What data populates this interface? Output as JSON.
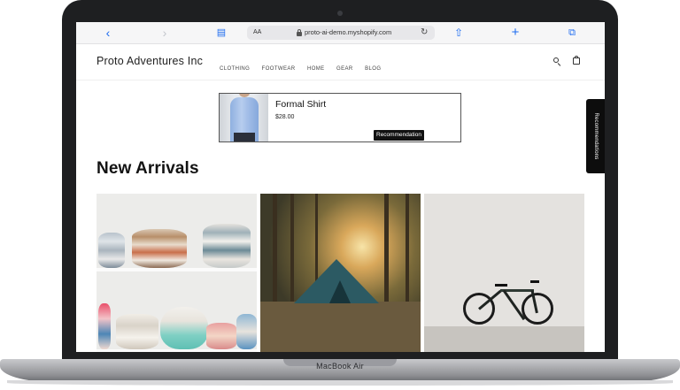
{
  "device": {
    "model_label": "MacBook Air"
  },
  "browser": {
    "url": "proto-ai-demo.myshopify.com",
    "text_size_label": "AA",
    "icons": [
      "chevron-left-icon",
      "chevron-right-icon",
      "book-icon",
      "lock-icon",
      "reload-icon",
      "share-icon",
      "plus-icon",
      "tabs-icon"
    ]
  },
  "store": {
    "name": "Proto Adventures Inc",
    "nav": [
      "CLOTHING",
      "FOOTWEAR",
      "HOME",
      "GEAR",
      "BLOG"
    ]
  },
  "recommendation": {
    "title": "Formal Shirt",
    "price": "$28.00",
    "badge": "Recommendation"
  },
  "side_tab": {
    "label": "Recommendations"
  },
  "section": {
    "title": "New Arrivals"
  },
  "colors": {
    "accent": "#1e6cf0",
    "badge_bg": "#111111"
  }
}
